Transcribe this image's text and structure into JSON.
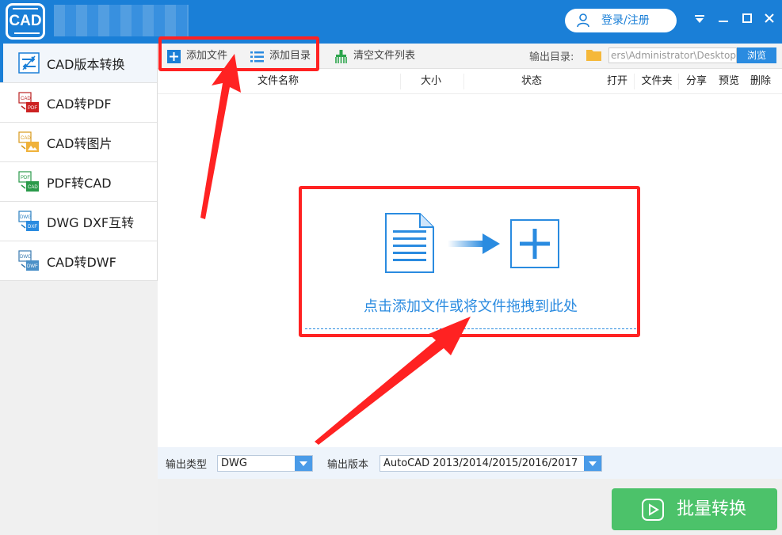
{
  "app": {
    "logo_text": "CAD",
    "login_label": "登录/注册"
  },
  "sidebar": {
    "items": [
      {
        "label": "CAD版本转换",
        "icon": "cad-version-convert-icon",
        "active": true
      },
      {
        "label": "CAD转PDF",
        "icon": "cad-to-pdf-icon",
        "active": false
      },
      {
        "label": "CAD转图片",
        "icon": "cad-to-image-icon",
        "active": false
      },
      {
        "label": "PDF转CAD",
        "icon": "pdf-to-cad-icon",
        "active": false
      },
      {
        "label": "DWG DXF互转",
        "icon": "dwg-dxf-convert-icon",
        "active": false
      },
      {
        "label": "CAD转DWF",
        "icon": "cad-to-dwf-icon",
        "active": false
      }
    ]
  },
  "toolbar": {
    "add_file": "添加文件",
    "add_folder": "添加目录",
    "clear_list": "清空文件列表",
    "output_dir_label": "输出目录:",
    "output_dir_value": "ers\\Administrator\\Desktop",
    "browse": "浏览"
  },
  "table": {
    "columns": [
      "文件名称",
      "大小",
      "状态",
      "打开",
      "文件夹",
      "分享",
      "预览",
      "删除"
    ]
  },
  "drop_zone": {
    "text": "点击添加文件或将文件拖拽到此处"
  },
  "options": {
    "output_type_label": "输出类型",
    "output_type_value": "DWG",
    "output_version_label": "输出版本",
    "output_version_value": "AutoCAD 2013/2014/2015/2016/2017"
  },
  "footer": {
    "convert_label": "批量转换"
  },
  "colors": {
    "brand_blue": "#1a7fd7",
    "accent_blue": "#2a8be0",
    "convert_green": "#4cc26a",
    "annotation_red": "#ff2222"
  }
}
